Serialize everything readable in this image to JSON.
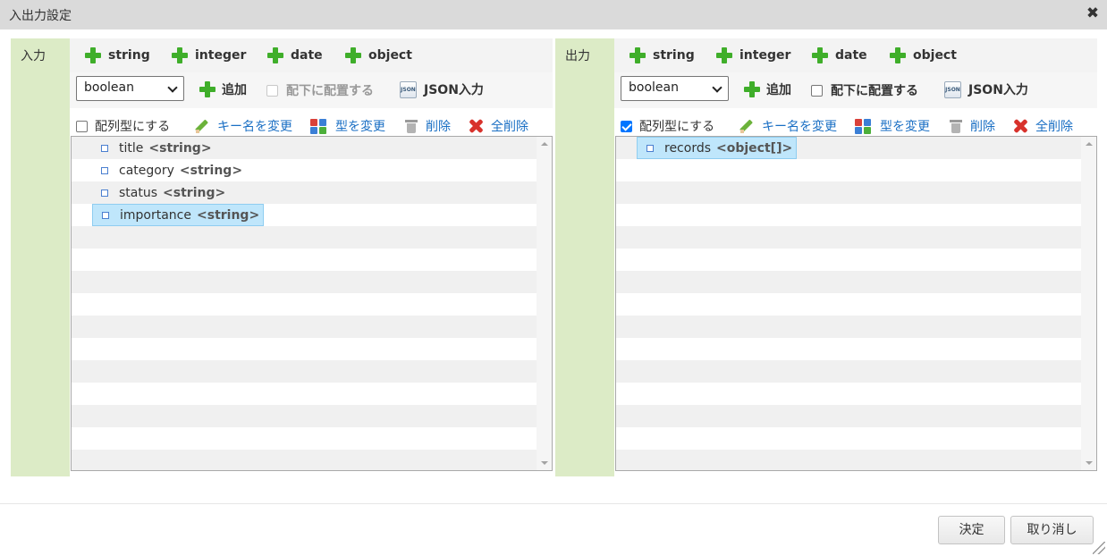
{
  "dialog": {
    "title": "入出力設定"
  },
  "input_panel": {
    "label": "入力",
    "types": [
      "string",
      "integer",
      "date",
      "object"
    ],
    "select_value": "boolean",
    "add_label": "追加",
    "place_under_label": "配下に配置する",
    "place_under_checked": false,
    "place_under_disabled": true,
    "json_label": "JSON入力",
    "array_label": "配列型にする",
    "array_checked": false,
    "actions": {
      "rename": "キー名を変更",
      "change_type": "型を変更",
      "delete": "削除",
      "delete_all": "全削除"
    },
    "nodes": [
      {
        "name": "title",
        "type": "<string>",
        "selected": false
      },
      {
        "name": "category",
        "type": "<string>",
        "selected": false
      },
      {
        "name": "status",
        "type": "<string>",
        "selected": false
      },
      {
        "name": "importance",
        "type": "<string>",
        "selected": true
      }
    ]
  },
  "output_panel": {
    "label": "出力",
    "types": [
      "string",
      "integer",
      "date",
      "object"
    ],
    "select_value": "boolean",
    "add_label": "追加",
    "place_under_label": "配下に配置する",
    "place_under_checked": false,
    "place_under_disabled": false,
    "json_label": "JSON入力",
    "array_label": "配列型にする",
    "array_checked": true,
    "actions": {
      "rename": "キー名を変更",
      "change_type": "型を変更",
      "delete": "削除",
      "delete_all": "全削除"
    },
    "nodes": [
      {
        "name": "records",
        "type": "<object[]>",
        "selected": true
      }
    ]
  },
  "footer": {
    "ok_label": "決定",
    "cancel_label": "取り消し"
  },
  "icons": {
    "close": "close-icon",
    "plus": "plus-icon",
    "json": "json-icon",
    "rename": "pencil-icon",
    "change_type": "swap-icon",
    "delete": "trash-icon",
    "delete_all": "x-icon"
  },
  "colors": {
    "side_label_bg": "#dcebc6",
    "link": "#1a6fc4",
    "plus": "#3fae2a",
    "selected_bg": "#bfe6fb"
  }
}
